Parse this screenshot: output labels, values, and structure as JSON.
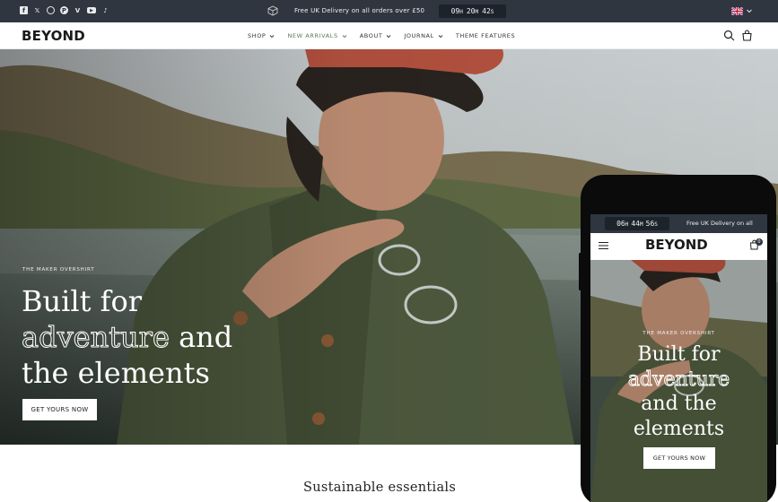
{
  "topbar": {
    "social_icons": [
      "facebook-icon",
      "x-icon",
      "instagram-icon",
      "pinterest-icon",
      "vimeo-icon",
      "youtube-icon",
      "tiktok-icon"
    ],
    "social_glyphs": [
      "f",
      "𝕏",
      "◎",
      "P",
      "V",
      "▶",
      "♪"
    ],
    "announcement": "Free UK Delivery on all orders over £50",
    "countdown": {
      "h": "09",
      "h_unit": "H",
      "m": "20",
      "m_unit": "M",
      "s": "42",
      "s_unit": "S"
    },
    "locale_flag": "uk-flag-icon",
    "background": "#2f3640"
  },
  "header": {
    "logo": "BEYOND",
    "nav": [
      {
        "label": "SHOP"
      },
      {
        "label": "NEW ARRIVALS"
      },
      {
        "label": "ABOUT"
      },
      {
        "label": "JOURNAL"
      },
      {
        "label": "THEME FEATURES"
      }
    ],
    "active_nav_color": "#5b7a55"
  },
  "hero": {
    "eyebrow": "THE MAKER OVERSHIRT",
    "title_line1": "Built for",
    "title_outline": "adventure",
    "title_line2_rest": " and",
    "title_line3": "the elements",
    "button": "GET YOURS NOW"
  },
  "section": {
    "title": "Sustainable essentials"
  },
  "mobile": {
    "countdown": {
      "h": "06",
      "h_unit": "H",
      "m": "44",
      "m_unit": "M",
      "s": "56",
      "s_unit": "S"
    },
    "announcement": "Free UK Delivery on all",
    "logo": "BEYOND",
    "cart_count": "0",
    "hero_eyebrow": "THE MAKER OVERSHIRT",
    "title_line1": "Built for",
    "title_outline": "adventure",
    "title_line3": "and the",
    "title_line4": "elements",
    "button": "GET YOURS NOW"
  }
}
